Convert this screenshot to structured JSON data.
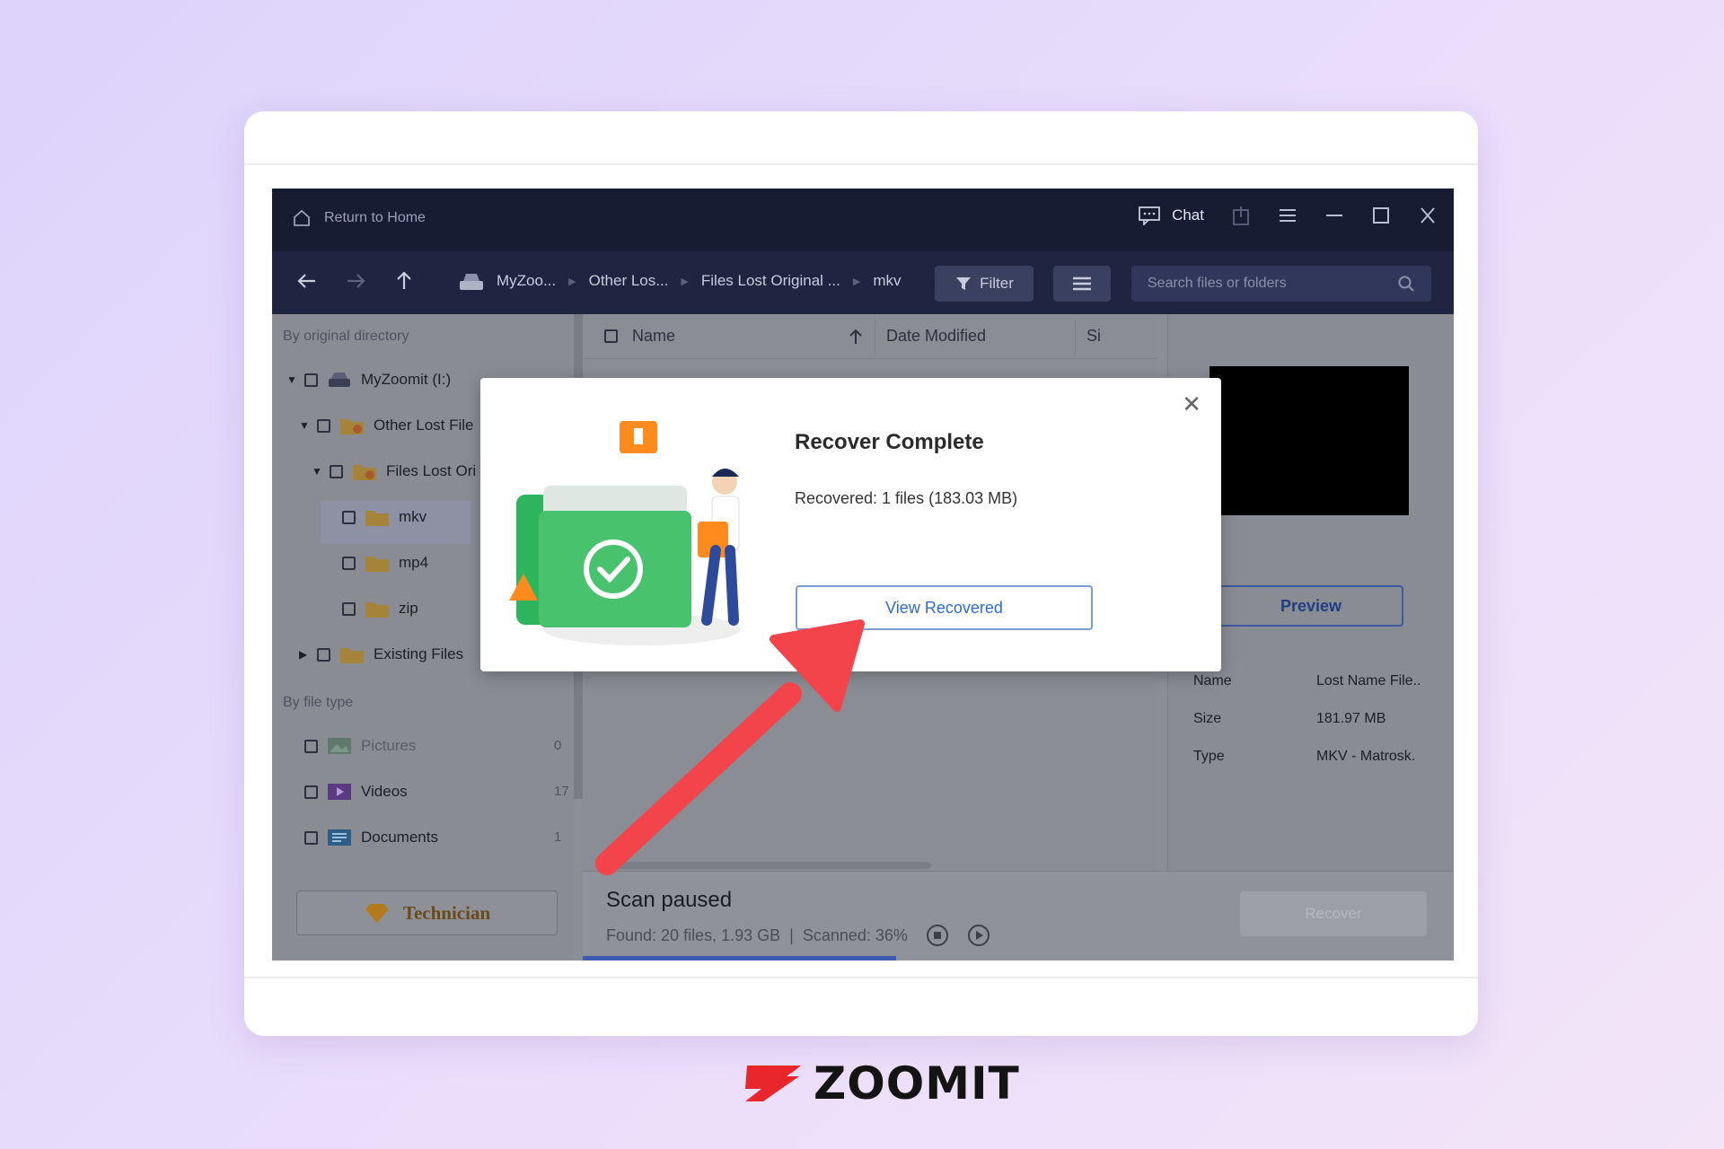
{
  "titlebar": {
    "home_label": "Return to Home",
    "chat_label": "Chat"
  },
  "nav": {
    "breadcrumbs": [
      "MyZoo...",
      "Other Los...",
      "Files Lost Original ...",
      "mkv"
    ],
    "filter_label": "Filter",
    "search_placeholder": "Search files or folders"
  },
  "sidebar": {
    "by_directory_label": "By original directory",
    "tree": [
      {
        "label": "MyZoomit (I:)"
      },
      {
        "label": "Other Lost File"
      },
      {
        "label": "Files Lost Ori"
      },
      {
        "label": "mkv"
      },
      {
        "label": "mp4"
      },
      {
        "label": "zip"
      },
      {
        "label": "Existing Files"
      }
    ],
    "by_type_label": "By file type",
    "types": [
      {
        "label": "Pictures",
        "count": "0"
      },
      {
        "label": "Videos",
        "count": "17"
      },
      {
        "label": "Documents",
        "count": "1"
      }
    ],
    "technician_label": "Technician"
  },
  "filelist": {
    "col_name": "Name",
    "col_date": "Date Modified",
    "col_size": "Si"
  },
  "details": {
    "preview_label": "Preview",
    "rows": [
      {
        "key": "Name",
        "value": "Lost Name File.."
      },
      {
        "key": "Size",
        "value": "181.97 MB"
      },
      {
        "key": "Type",
        "value": "MKV - Matrosk."
      }
    ]
  },
  "status": {
    "title": "Scan paused",
    "found": "Found: 20 files, 1.93 GB",
    "divider": "|",
    "scanned": "Scanned: 36%",
    "progress_percent": 36,
    "recover_label": "Recover"
  },
  "modal": {
    "title": "Recover Complete",
    "message": "Recovered: 1 files (183.03 MB)",
    "button_label": "View Recovered"
  },
  "brand": {
    "logo_text": "ZOOMIT",
    "accent": "#e8262b"
  }
}
